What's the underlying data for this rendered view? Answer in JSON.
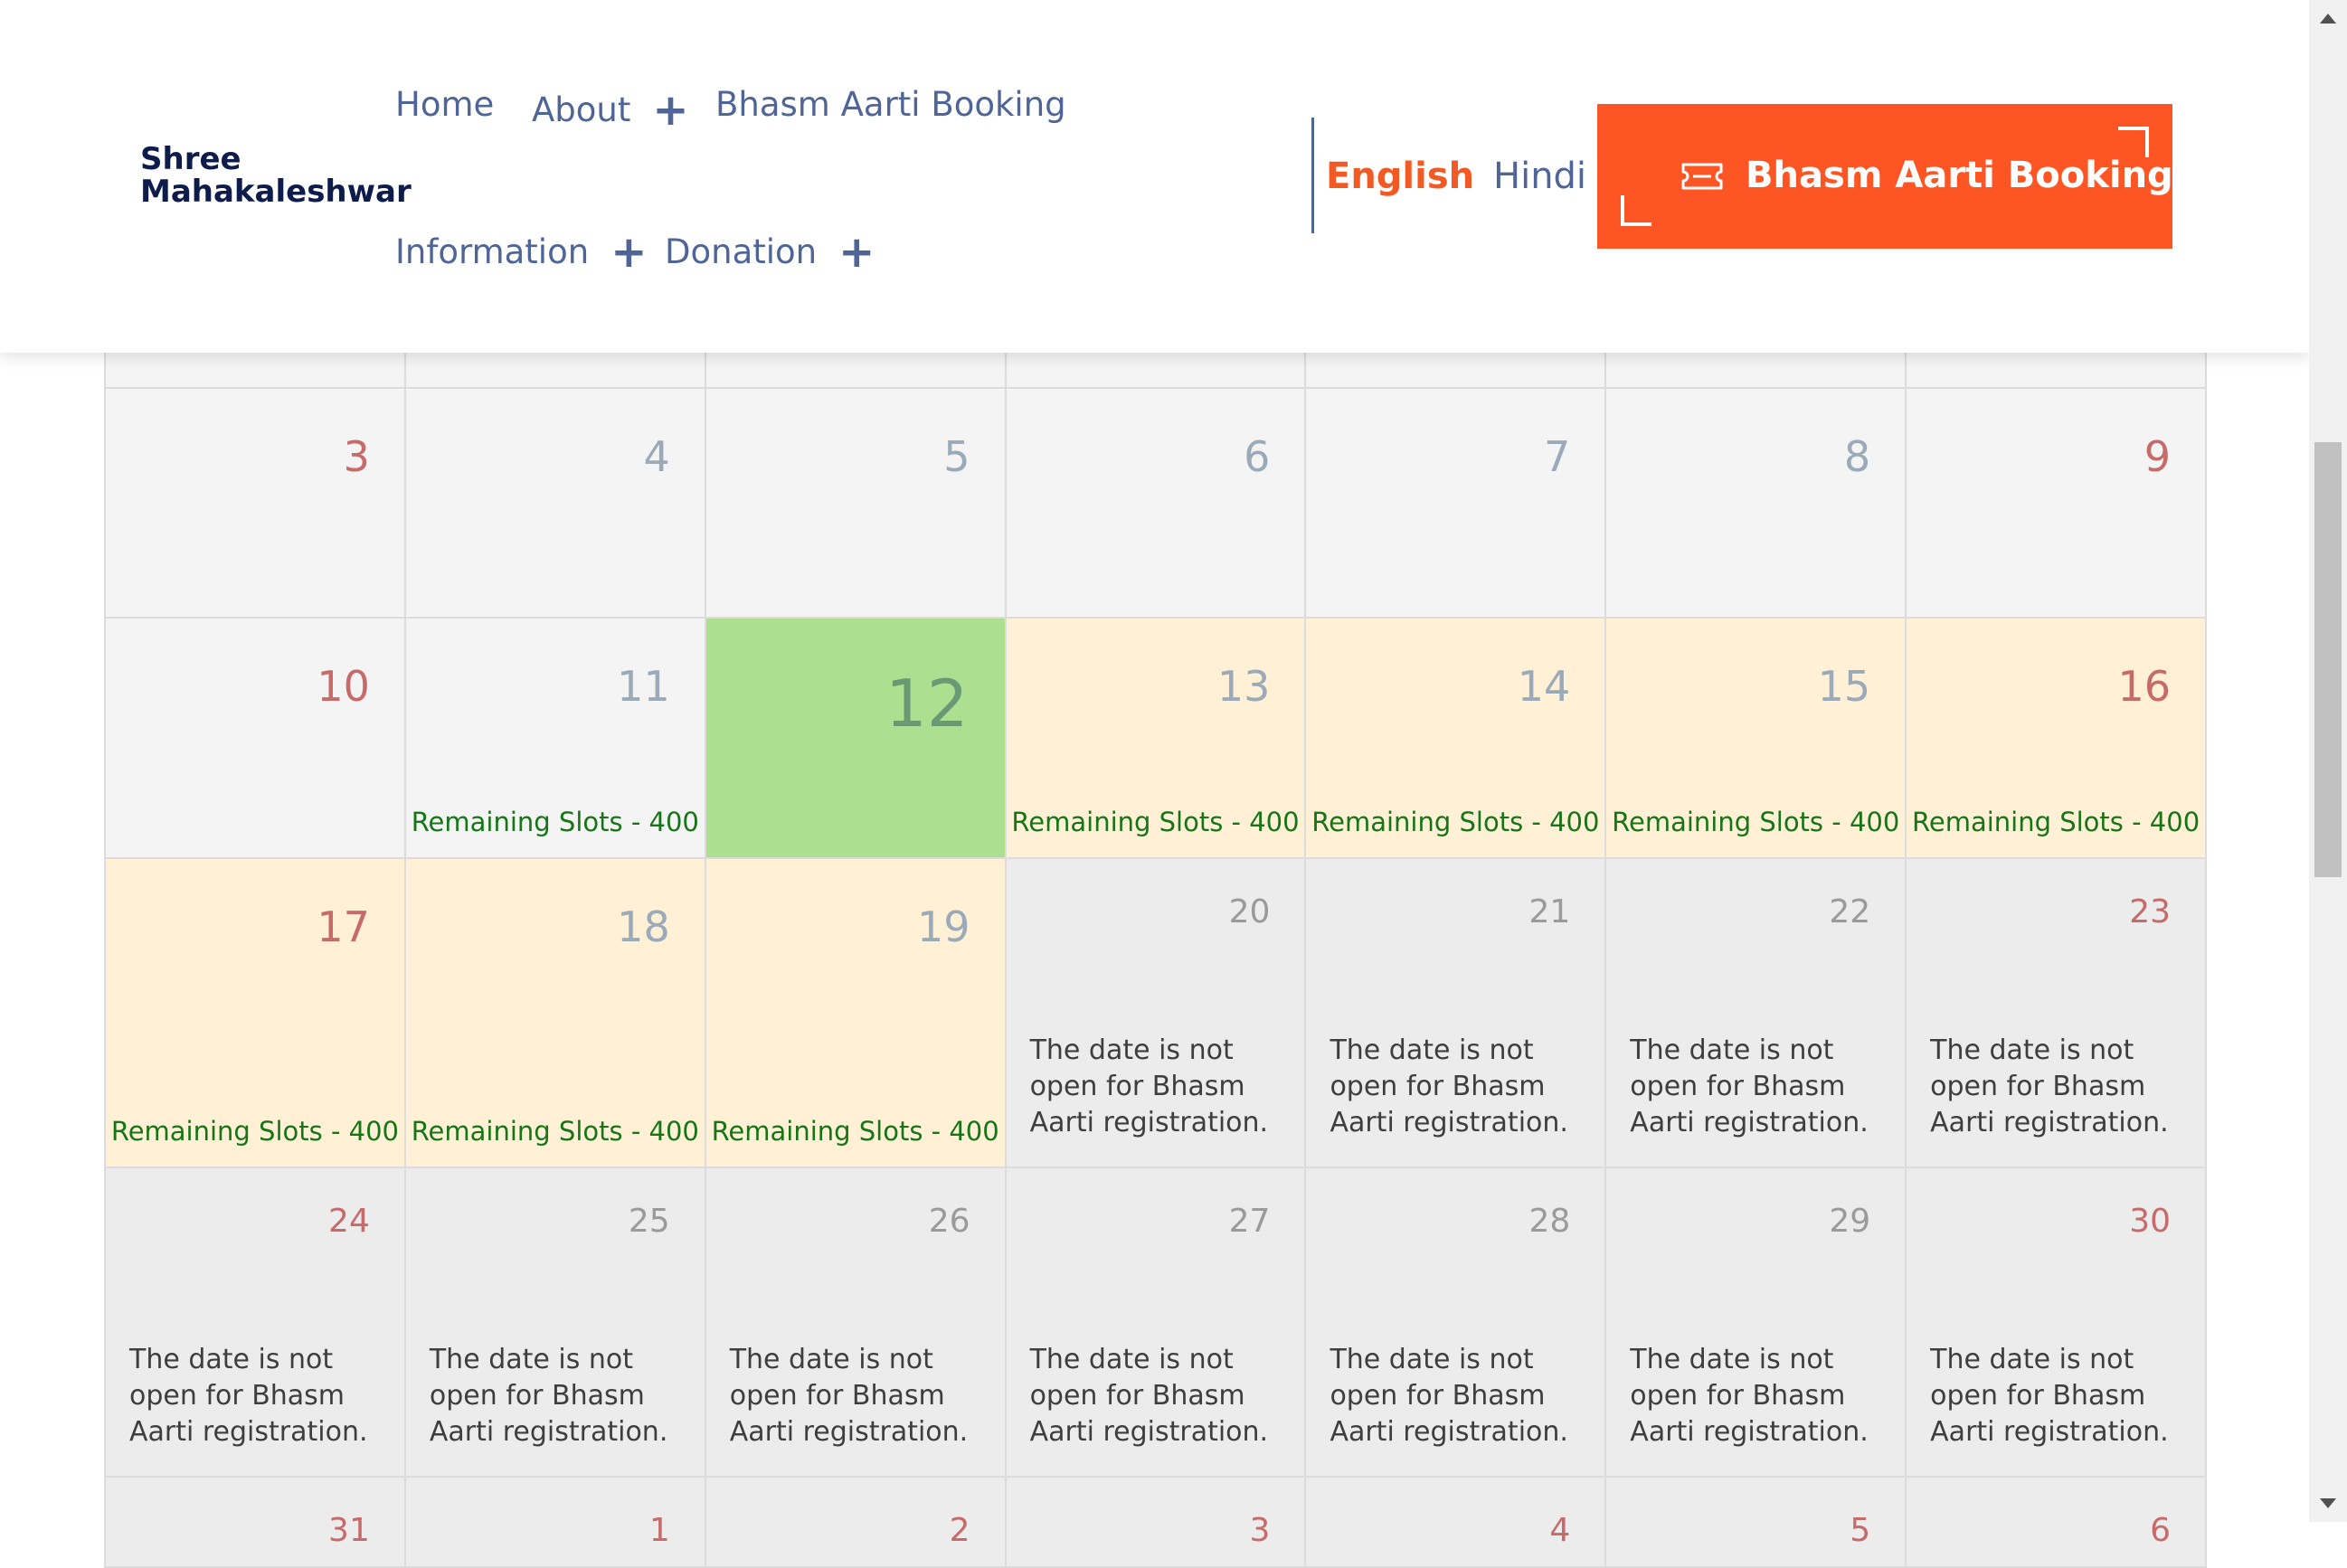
{
  "header": {
    "logo_line1": "Shree",
    "logo_line2": "Mahakaleshwar",
    "nav": {
      "home": "Home",
      "about": "About",
      "bhasm_aarti_booking": "Bhasm Aarti Booking",
      "information": "Information",
      "donation": "Donation"
    },
    "lang_english": "English",
    "lang_hindi": "Hindi",
    "cta_label": "Bhasm Aarti Booking",
    "accent_color": "#fd5624",
    "nav_color": "#4f6598"
  },
  "calendar": {
    "week_a": [
      {
        "day": "3",
        "weekend": true,
        "status": "past"
      },
      {
        "day": "4",
        "weekend": false,
        "status": "past"
      },
      {
        "day": "5",
        "weekend": false,
        "status": "past"
      },
      {
        "day": "6",
        "weekend": false,
        "status": "past"
      },
      {
        "day": "7",
        "weekend": false,
        "status": "past"
      },
      {
        "day": "8",
        "weekend": false,
        "status": "past"
      },
      {
        "day": "9",
        "weekend": true,
        "status": "past"
      }
    ],
    "week_b": [
      {
        "day": "10",
        "weekend": true,
        "status": "past",
        "info": ""
      },
      {
        "day": "11",
        "weekend": false,
        "status": "past",
        "info": "Remaining Slots - 400"
      },
      {
        "day": "12",
        "weekend": false,
        "status": "today",
        "info": ""
      },
      {
        "day": "13",
        "weekend": false,
        "status": "open",
        "info": "Remaining Slots - 400"
      },
      {
        "day": "14",
        "weekend": false,
        "status": "open",
        "info": "Remaining Slots - 400"
      },
      {
        "day": "15",
        "weekend": false,
        "status": "open",
        "info": "Remaining Slots - 400"
      },
      {
        "day": "16",
        "weekend": true,
        "status": "open",
        "info": "Remaining Slots - 400"
      }
    ],
    "week_c": [
      {
        "day": "17",
        "weekend": true,
        "status": "open",
        "info": "Remaining Slots - 400"
      },
      {
        "day": "18",
        "weekend": false,
        "status": "open",
        "info": "Remaining Slots - 400"
      },
      {
        "day": "19",
        "weekend": false,
        "status": "open",
        "info": "Remaining Slots - 400"
      },
      {
        "day": "20",
        "weekend": false,
        "status": "closed",
        "info": "The date is not open for Bhasm Aarti registration."
      },
      {
        "day": "21",
        "weekend": false,
        "status": "closed",
        "info": "The date is not open for Bhasm Aarti registration."
      },
      {
        "day": "22",
        "weekend": false,
        "status": "closed",
        "info": "The date is not open for Bhasm Aarti registration."
      },
      {
        "day": "23",
        "weekend": true,
        "status": "closed",
        "info": "The date is not open for Bhasm Aarti registration."
      }
    ],
    "week_d": [
      {
        "day": "24",
        "weekend": true,
        "status": "closed",
        "info": "The date is not open for Bhasm Aarti registration."
      },
      {
        "day": "25",
        "weekend": false,
        "status": "closed",
        "info": "The date is not open for Bhasm Aarti registration."
      },
      {
        "day": "26",
        "weekend": false,
        "status": "closed",
        "info": "The date is not open for Bhasm Aarti registration."
      },
      {
        "day": "27",
        "weekend": false,
        "status": "closed",
        "info": "The date is not open for Bhasm Aarti registration."
      },
      {
        "day": "28",
        "weekend": false,
        "status": "closed",
        "info": "The date is not open for Bhasm Aarti registration."
      },
      {
        "day": "29",
        "weekend": false,
        "status": "closed",
        "info": "The date is not open for Bhasm Aarti registration."
      },
      {
        "day": "30",
        "weekend": true,
        "status": "closed",
        "info": "The date is not open for Bhasm Aarti registration."
      }
    ],
    "week_e_partial": [
      "31",
      "1",
      "2",
      "3",
      "4",
      "5",
      "6"
    ],
    "colors": {
      "today": "#addf91",
      "open": "#fff0d6",
      "closed": "#ececec",
      "past": "#f4f4f4",
      "slots_text": "#167516",
      "weekend_number": "#c66a6a"
    }
  },
  "scrollbar": {
    "position_fraction": 0.28,
    "visible_fraction": 0.3
  }
}
